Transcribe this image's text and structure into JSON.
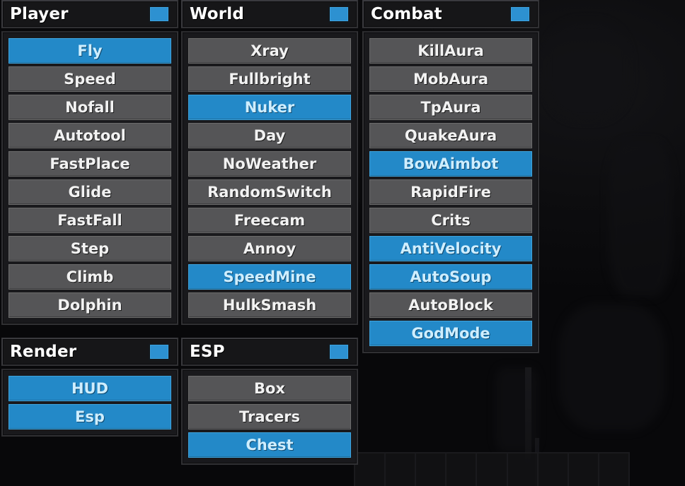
{
  "background": {
    "hotbar_slots": 9,
    "accent_color": "#2389c8",
    "inactive_color": "#555557",
    "panel_color": "#19191c",
    "header_color": "#161618"
  },
  "windows": [
    {
      "id": "player",
      "title": "Player",
      "toggle": "enabled",
      "modules": [
        {
          "label": "Fly",
          "enabled": true
        },
        {
          "label": "Speed",
          "enabled": false
        },
        {
          "label": "Nofall",
          "enabled": false
        },
        {
          "label": "Autotool",
          "enabled": false
        },
        {
          "label": "FastPlace",
          "enabled": false
        },
        {
          "label": "Glide",
          "enabled": false
        },
        {
          "label": "FastFall",
          "enabled": false
        },
        {
          "label": "Step",
          "enabled": false
        },
        {
          "label": "Climb",
          "enabled": false
        },
        {
          "label": "Dolphin",
          "enabled": false
        }
      ]
    },
    {
      "id": "world",
      "title": "World",
      "toggle": "enabled",
      "modules": [
        {
          "label": "Xray",
          "enabled": false
        },
        {
          "label": "Fullbright",
          "enabled": false
        },
        {
          "label": "Nuker",
          "enabled": true
        },
        {
          "label": "Day",
          "enabled": false
        },
        {
          "label": "NoWeather",
          "enabled": false
        },
        {
          "label": "RandomSwitch",
          "enabled": false
        },
        {
          "label": "Freecam",
          "enabled": false
        },
        {
          "label": "Annoy",
          "enabled": false
        },
        {
          "label": "SpeedMine",
          "enabled": true
        },
        {
          "label": "HulkSmash",
          "enabled": false
        }
      ]
    },
    {
      "id": "combat",
      "title": "Combat",
      "toggle": "enabled",
      "modules": [
        {
          "label": "KillAura",
          "enabled": false
        },
        {
          "label": "MobAura",
          "enabled": false
        },
        {
          "label": "TpAura",
          "enabled": false
        },
        {
          "label": "QuakeAura",
          "enabled": false
        },
        {
          "label": "BowAimbot",
          "enabled": true
        },
        {
          "label": "RapidFire",
          "enabled": false
        },
        {
          "label": "Crits",
          "enabled": false
        },
        {
          "label": "AntiVelocity",
          "enabled": true
        },
        {
          "label": "AutoSoup",
          "enabled": true
        },
        {
          "label": "AutoBlock",
          "enabled": false
        },
        {
          "label": "GodMode",
          "enabled": true
        }
      ]
    },
    {
      "id": "render",
      "title": "Render",
      "toggle": "enabled",
      "modules": [
        {
          "label": "HUD",
          "enabled": true
        },
        {
          "label": "Esp",
          "enabled": true
        }
      ]
    },
    {
      "id": "esp",
      "title": "ESP",
      "toggle": "enabled",
      "modules": [
        {
          "label": "Box",
          "enabled": false
        },
        {
          "label": "Tracers",
          "enabled": false
        },
        {
          "label": "Chest",
          "enabled": true
        }
      ]
    }
  ]
}
